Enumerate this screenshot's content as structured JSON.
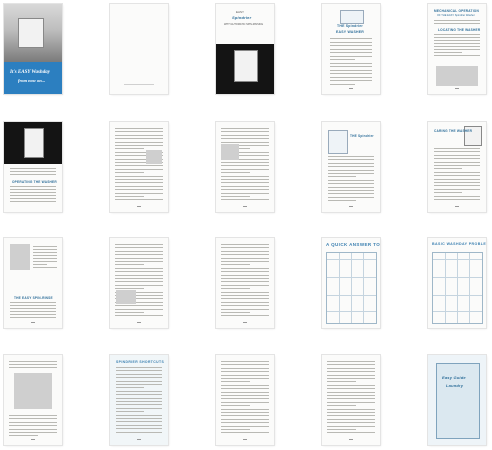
{
  "document": {
    "pages": [
      {
        "page": 1,
        "texts": [
          "It's EASY Washday",
          "from now on..."
        ]
      },
      {
        "page": 2,
        "texts": []
      },
      {
        "page": 3,
        "texts": [
          "EASY",
          "Spindrier",
          "WITH AUTOMATIC SPIN-RINSING"
        ]
      },
      {
        "page": 4,
        "texts": [
          "THE Spindrier",
          "EASY WASHER"
        ]
      },
      {
        "page": 5,
        "texts": [
          "MECHANICAL OPERATION",
          "OF THE EASY Spindrier Washer",
          "LOCATING THE WASHER"
        ]
      },
      {
        "page": 6,
        "texts": [
          "OPERATING THE WASHER"
        ]
      },
      {
        "page": 7,
        "texts": []
      },
      {
        "page": 8,
        "texts": []
      },
      {
        "page": 9,
        "texts": [
          "THE Spindrier"
        ]
      },
      {
        "page": 10,
        "texts": [
          "CARING THE WASHER"
        ]
      },
      {
        "page": 11,
        "texts": [
          "THE EASY SPIN-RINSE"
        ]
      },
      {
        "page": 12,
        "texts": []
      },
      {
        "page": 13,
        "texts": []
      },
      {
        "page": 14,
        "texts": [
          "A QUICK ANSWER TO 24"
        ]
      },
      {
        "page": 15,
        "texts": [
          "BASIC WASHDAY PROBLEMS"
        ]
      },
      {
        "page": 16,
        "texts": []
      },
      {
        "page": 17,
        "texts": [
          "SPINDRIER SHORTCUTS"
        ]
      },
      {
        "page": 18,
        "texts": []
      },
      {
        "page": 19,
        "texts": []
      },
      {
        "page": 20,
        "texts": [
          "Easy Guide",
          "Laundry"
        ]
      }
    ]
  }
}
